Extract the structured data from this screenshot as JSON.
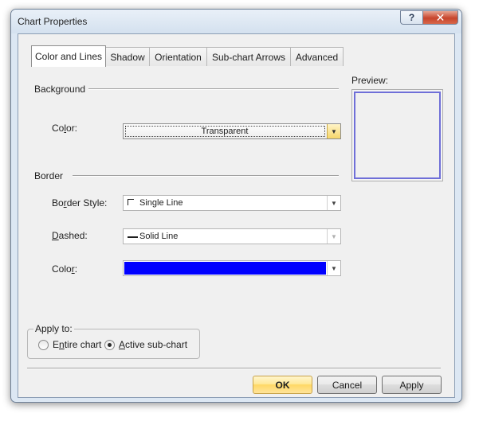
{
  "window": {
    "title": "Chart Properties",
    "help_label": "?",
    "close_label": "✕"
  },
  "tabs": [
    {
      "label": "Color and Lines",
      "active": true
    },
    {
      "label": "Shadow",
      "active": false
    },
    {
      "label": "Orientation",
      "active": false
    },
    {
      "label": "Sub-chart Arrows",
      "active": false
    },
    {
      "label": "Advanced",
      "active": false
    }
  ],
  "background": {
    "section_label": "Background",
    "color_label": "Color:",
    "color_value": "Transparent"
  },
  "border": {
    "section_label": "Border",
    "style_label": "Border Style:",
    "style_value": "Single Line",
    "dashed_label": "Dashed:",
    "dashed_value": "Solid Line",
    "color_label": "Color:",
    "color_swatch": "#0000ff"
  },
  "preview": {
    "label": "Preview:"
  },
  "apply_to": {
    "title": "Apply to:",
    "options": [
      {
        "label": "Entire chart",
        "checked": false
      },
      {
        "label": "Active sub-chart",
        "checked": true
      }
    ]
  },
  "buttons": {
    "ok": "OK",
    "cancel": "Cancel",
    "apply": "Apply"
  },
  "colors": {
    "accent_default_button": "#ffd865",
    "preview_border": "#6f6fd8"
  }
}
